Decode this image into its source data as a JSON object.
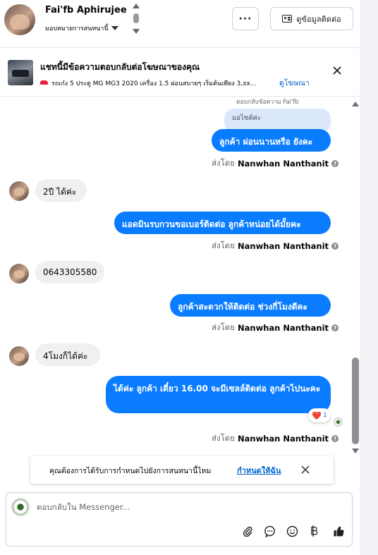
{
  "header": {
    "contact_name": "Fai'fb Aphirujee",
    "assign_label": "มอบหมายการสนทนานี้",
    "more_label": "···",
    "contact_info_label": "ดูข้อมูลติดต่อ"
  },
  "ad_banner": {
    "title": "แชทนี้มีข้อความตอบกลับต่อโฆษณาของคุณ",
    "description": "รถเก๋ง 5 ประตู MG MG3 2020 เครื่อง 1.5 ผ่อนสบายๆ เริ่มต้นเพียง 3,xx...",
    "link_label": "ดูโฆษณา"
  },
  "chat": {
    "reply_reference": "ตอบกลับข้อความ Fai'fb",
    "quoted_text": "มอไซค์ค่ะ",
    "sent_by_prefix": "ส่งโดย",
    "sender_name": "Nanwhan Nanthanit",
    "messages": [
      {
        "direction": "out",
        "text": "ลูกค้า ผ่อนนานหรือ ยังคะ"
      },
      {
        "direction": "in",
        "text": "2ปี ได้ค่ะ"
      },
      {
        "direction": "out",
        "text": "แอดมินรบกวนขอเบอร์ติดต่อ ลูกค้าหน่อยได้มั้ยคะ"
      },
      {
        "direction": "in",
        "text": "0643305580"
      },
      {
        "direction": "out",
        "text": "ลูกค้าสะดวกให้ติดต่อ ช่วงกี่โมงดีคะ"
      },
      {
        "direction": "in",
        "text": "4โมงก็ได้ค่ะ"
      },
      {
        "direction": "out",
        "text": "ได้ค่ะ  ลูกค้า เดี๋ยว 16.00 จะมีเซลล์ติดต่อ ลูกค้าไปนะคะ"
      }
    ],
    "reaction": {
      "emoji": "❤️",
      "count": "1"
    }
  },
  "prompt": {
    "text": "คุณต้องการได้รับการกำหนดไปยังการสนทนานี้ไหม",
    "link_label": "กำหนดให้ฉัน"
  },
  "composer": {
    "placeholder": "ตอบกลับใน Messenger...",
    "tools": [
      "attachment-icon",
      "saved-reply-icon",
      "emoji-icon",
      "baht-icon",
      "like-icon"
    ]
  },
  "colors": {
    "accent": "#0a7cff",
    "link": "#0064d1",
    "incoming_bubble": "#f0f0f0",
    "quoted_bubble": "#dbe7fa"
  }
}
